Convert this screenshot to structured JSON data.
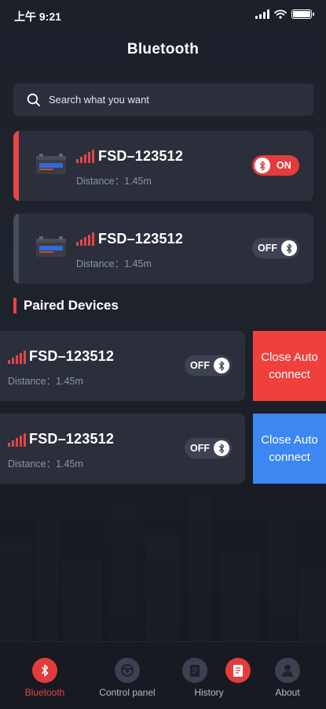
{
  "status_bar": {
    "time": "上午 9:21",
    "icons": [
      "cellular-signal-icon",
      "wifi-icon",
      "battery-icon"
    ]
  },
  "header": {
    "title": "Bluetooth"
  },
  "search": {
    "placeholder": "Search what you want",
    "icon": "search-icon"
  },
  "devices": [
    {
      "name": "FSD–123512",
      "distance": "Distance：1.45m",
      "toggle": "ON",
      "state": "on"
    },
    {
      "name": "FSD–123512",
      "distance": "Distance：1.45m",
      "toggle": "OFF",
      "state": "off"
    }
  ],
  "paired": {
    "title": "Paired Devices",
    "items": [
      {
        "name": "FSD–123512",
        "distance": "Distance：1.45m",
        "toggle": "OFF",
        "action": "Close Auto connect",
        "action_color": "#f0403c"
      },
      {
        "name": "FSD–123512",
        "distance": "Distance：1.45m",
        "toggle": "OFF",
        "action": "Close Auto connect",
        "action_color": "#3c87f2"
      }
    ]
  },
  "tabbar": {
    "items": [
      {
        "label": "Bluetooth",
        "icon": "bluetooth-icon",
        "active": true
      },
      {
        "label": "Control panel",
        "icon": "steering-wheel-icon",
        "active": false
      },
      {
        "label": "History",
        "icon": "history-document-icon",
        "active": false
      },
      {
        "label": "About",
        "icon": "user-icon",
        "active": false
      }
    ]
  },
  "colors": {
    "accent_red": "#e23c3c",
    "accent_blue": "#3c87f2",
    "background": "#1c2029",
    "card": "#2a2f3b"
  }
}
